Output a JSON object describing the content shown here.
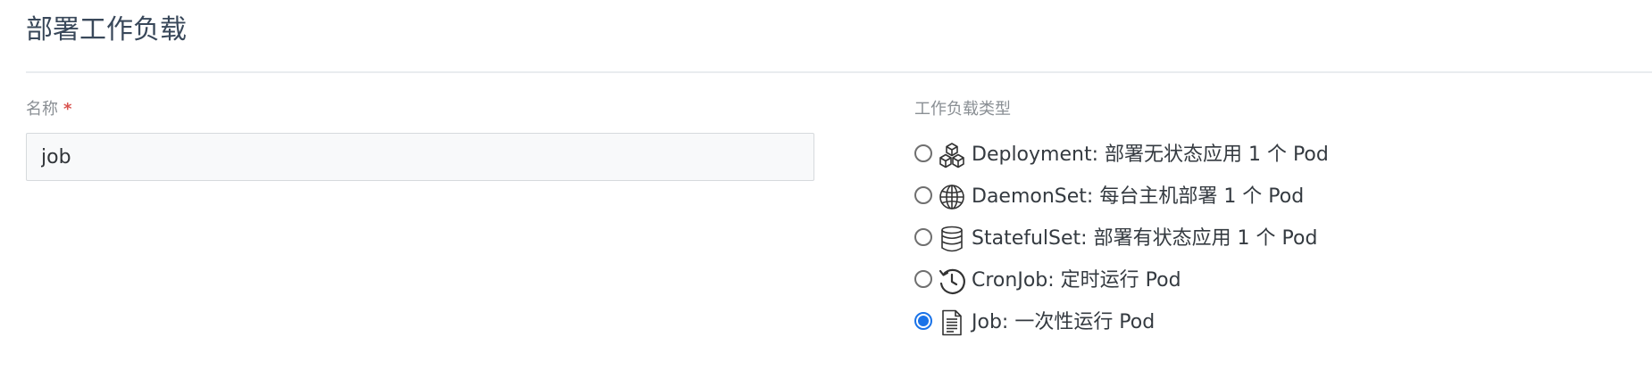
{
  "page": {
    "title": "部署工作负载"
  },
  "name_field": {
    "label": "名称",
    "required_mark": "*",
    "value": "job"
  },
  "workload_type": {
    "label": "工作负载类型",
    "options": [
      {
        "icon": "cubes-icon",
        "label": "Deployment: 部署无状态应用 1 个 Pod",
        "checked": false
      },
      {
        "icon": "globe-icon",
        "label": "DaemonSet: 每台主机部署 1 个 Pod",
        "checked": false
      },
      {
        "icon": "database-icon",
        "label": "StatefulSet: 部署有状态应用 1 个 Pod",
        "checked": false
      },
      {
        "icon": "history-clock-icon",
        "label": "CronJob: 定时运行 Pod",
        "checked": false
      },
      {
        "icon": "document-icon",
        "label": "Job: 一次性运行 Pod",
        "checked": true
      }
    ],
    "accent_color": "#1a73e8"
  }
}
